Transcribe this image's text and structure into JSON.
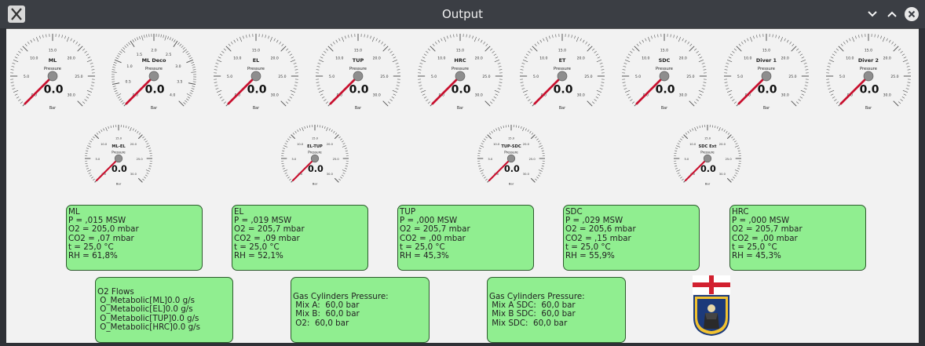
{
  "window": {
    "title": "Output"
  },
  "gauges_row1": [
    {
      "name": "ML",
      "unit": "Bar",
      "sub": "Pressure",
      "value": "0.0",
      "ticks": [
        "0.0",
        "5.0",
        "10.0",
        "15.0",
        "20.0",
        "25.0",
        "30.0"
      ],
      "min": 0,
      "max": 30,
      "level": 0
    },
    {
      "name": "ML Deco",
      "unit": "Bar",
      "sub": "Pressure",
      "value": "0.0",
      "ticks": [
        "0.0",
        "0.5",
        "1.0",
        "1.5",
        "2.0",
        "2.5",
        "3.0",
        "3.5",
        "4.0"
      ],
      "min": 0,
      "max": 4,
      "level": 0
    },
    {
      "name": "EL",
      "unit": "Bar",
      "sub": "Pressure",
      "value": "0.0",
      "ticks": [
        "0.0",
        "5.0",
        "10.0",
        "15.0",
        "20.0",
        "25.0",
        "30.0"
      ],
      "min": 0,
      "max": 30,
      "level": 0
    },
    {
      "name": "TUP",
      "unit": "Bar",
      "sub": "Pressure",
      "value": "0.0",
      "ticks": [
        "0.0",
        "5.0",
        "10.0",
        "15.0",
        "20.0",
        "25.0",
        "30.0"
      ],
      "min": 0,
      "max": 30,
      "level": 0
    },
    {
      "name": "HRC",
      "unit": "Bar",
      "sub": "Pressure",
      "value": "0.0",
      "ticks": [
        "0.0",
        "5.0",
        "10.0",
        "15.0",
        "20.0",
        "25.0",
        "30.0"
      ],
      "min": 0,
      "max": 30,
      "level": 0
    },
    {
      "name": "ET",
      "unit": "Bar",
      "sub": "Pressure",
      "value": "0.0",
      "ticks": [
        "0.0",
        "5.0",
        "10.0",
        "15.0",
        "20.0",
        "25.0",
        "30.0"
      ],
      "min": 0,
      "max": 30,
      "level": 0
    },
    {
      "name": "SDC",
      "unit": "Bar",
      "sub": "Pressure",
      "value": "0.0",
      "ticks": [
        "0.0",
        "5.0",
        "10.0",
        "15.0",
        "20.0",
        "25.0",
        "30.0"
      ],
      "min": 0,
      "max": 30,
      "level": 0
    },
    {
      "name": "Diver 1",
      "unit": "Bar",
      "sub": "Pressure",
      "value": "0.0",
      "ticks": [
        "0.0",
        "5.0",
        "10.0",
        "15.0",
        "20.0",
        "25.0",
        "30.0"
      ],
      "min": 0,
      "max": 30,
      "level": 0
    },
    {
      "name": "Diver 2",
      "unit": "Bar",
      "sub": "Pressure",
      "value": "0.0",
      "ticks": [
        "0.0",
        "5.0",
        "10.0",
        "15.0",
        "20.0",
        "25.0",
        "30.0"
      ],
      "min": 0,
      "max": 30,
      "level": 0
    }
  ],
  "gauges_row2": [
    {
      "name": "ML-EL",
      "unit": "Bar",
      "sub": "Pressure",
      "value": "0.0",
      "ticks": [
        "0.0",
        "5.0",
        "10.0",
        "15.0",
        "20.0",
        "25.0",
        "30.0"
      ],
      "min": 0,
      "max": 30,
      "level": 0
    },
    {
      "name": "EL-TUP",
      "unit": "Bar",
      "sub": "Pressure",
      "value": "0.0",
      "ticks": [
        "0.0",
        "5.0",
        "10.0",
        "15.0",
        "20.0",
        "25.0",
        "30.0"
      ],
      "min": 0,
      "max": 30,
      "level": 0
    },
    {
      "name": "TUP-SDC",
      "unit": "Bar",
      "sub": "Pressure",
      "value": "0.0",
      "ticks": [
        "0.0",
        "5.0",
        "10.0",
        "15.0",
        "20.0",
        "25.0",
        "30.0"
      ],
      "min": 0,
      "max": 30,
      "level": 0
    },
    {
      "name": "SDC Ext",
      "unit": "Bar",
      "sub": "Pressure",
      "value": "0.0",
      "ticks": [
        "0.0",
        "5.0",
        "10.0",
        "15.0",
        "20.0",
        "25.0",
        "30.0"
      ],
      "min": 0,
      "max": 30,
      "level": 0
    }
  ],
  "status_boxes": [
    {
      "lines": [
        "ML",
        "P = ,015 MSW",
        "O2 = 205,0 mbar",
        "CO2 = ,07 mbar",
        "t = 25,0 °C",
        "RH = 61,8%"
      ]
    },
    {
      "lines": [
        "EL",
        "P = ,019 MSW",
        "O2 = 205,7 mbar",
        "CO2 = ,09 mbar",
        "t = 25,0 °C",
        "RH = 52,1%"
      ]
    },
    {
      "lines": [
        "TUP",
        "P = ,000 MSW",
        "O2 = 205,7 mbar",
        "CO2 = ,00 mbar",
        "t = 25,0 °C",
        "RH = 45,3%"
      ]
    },
    {
      "lines": [
        "SDC",
        "P = ,029 MSW",
        "O2 = 205,6 mbar",
        "CO2 = ,15 mbar",
        "t = 25,0 °C",
        "RH = 55,9%"
      ]
    },
    {
      "lines": [
        "HRC",
        "P = ,000 MSW",
        "O2 = 205,7 mbar",
        "CO2 = ,00 mbar",
        "t = 25,0 °C",
        "RH = 45,3%"
      ]
    }
  ],
  "o2_flows": {
    "lines": [
      "O2 Flows",
      " O_Metabolic[ML]0.0 g/s",
      " O_Metabolic[EL]0.0 g/s",
      " O_Metabolic[TUP]0.0 g/s",
      " O_Metabolic[HRC]0.0 g/s"
    ]
  },
  "gas_cyl_1": {
    "lines": [
      "Gas Cylinders Pressure:",
      " Mix A:  60,0 bar",
      " Mix B:  60,0 bar",
      " O2:  60,0 bar"
    ]
  },
  "gas_cyl_2": {
    "lines": [
      "Gas Cylinders Pressure:",
      " Mix A SDC:  60,0 bar",
      " Mix B SDC:  60,0 bar",
      " Mix SDC:  60,0 bar"
    ]
  },
  "colors": {
    "panel": "#90ee90",
    "needle": "#c8102e",
    "window_bg": "#f2f2f2",
    "titlebar": "#3b3e44"
  },
  "icons": {
    "app": "x-app-icon",
    "minimize": "chevron-down-icon",
    "maximize": "chevron-up-icon",
    "close": "close-icon",
    "logo": "shield-crest-logo"
  }
}
